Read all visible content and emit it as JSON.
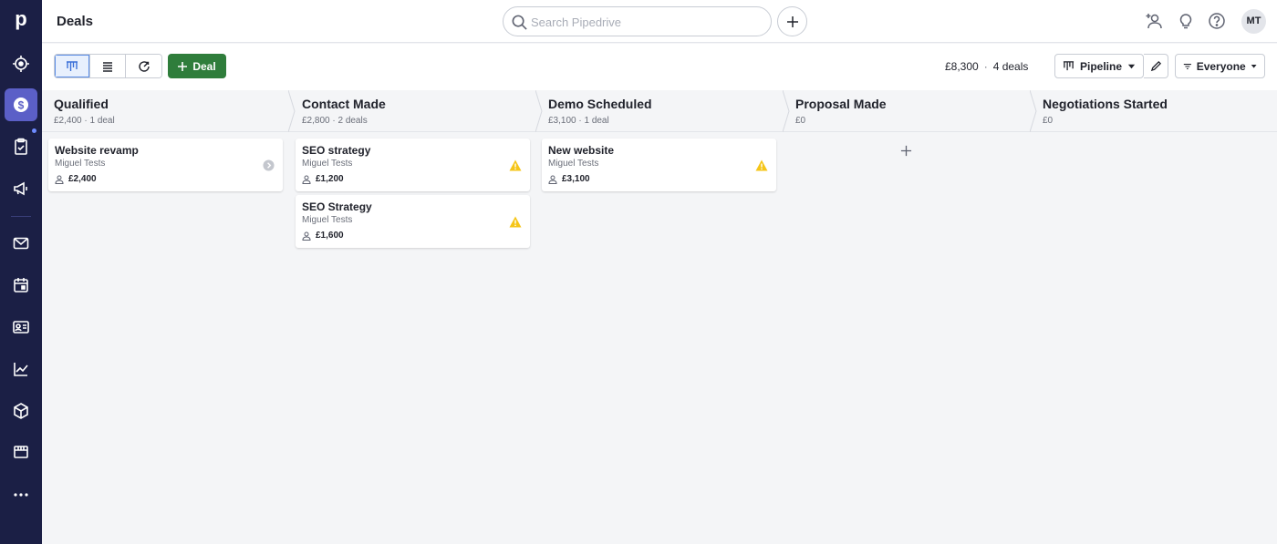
{
  "app": {
    "logo": "p"
  },
  "sidebar": {
    "items": [
      {
        "icon": "target-icon",
        "name": "leads"
      },
      {
        "icon": "dollar-icon",
        "name": "deals",
        "active": true
      },
      {
        "icon": "clipboard-check-icon",
        "name": "activities"
      },
      {
        "icon": "megaphone-icon",
        "name": "campaigns"
      },
      {
        "icon": "mail-icon",
        "name": "mail"
      },
      {
        "icon": "calendar-icon",
        "name": "calendar"
      },
      {
        "icon": "contacts-card-icon",
        "name": "contacts"
      },
      {
        "icon": "chart-line-icon",
        "name": "insights"
      },
      {
        "icon": "box-icon",
        "name": "products"
      },
      {
        "icon": "store-icon",
        "name": "marketplace"
      },
      {
        "icon": "more-dots-icon",
        "name": "more"
      }
    ]
  },
  "header": {
    "title": "Deals",
    "search_placeholder": "Search Pipedrive",
    "avatar_initials": "MT"
  },
  "toolbar": {
    "add_deal_label": "Deal",
    "summary_value": "£8,300",
    "summary_separator": "·",
    "summary_count": "4 deals",
    "pipeline_label": "Pipeline",
    "filter_label": "Everyone"
  },
  "stages": [
    {
      "name": "Qualified",
      "meta": "£2,400 · 1 deal"
    },
    {
      "name": "Contact Made",
      "meta": "£2,800 · 2 deals"
    },
    {
      "name": "Demo Scheduled",
      "meta": "£3,100 · 1 deal"
    },
    {
      "name": "Proposal Made",
      "meta": "£0"
    },
    {
      "name": "Negotiations Started",
      "meta": "£0"
    }
  ],
  "deals": [
    {
      "title": "Website revamp",
      "owner": "Miguel Tests",
      "value": "£2,400",
      "status": "neutral-arrow-icon"
    },
    {
      "title": "SEO strategy",
      "owner": "Miguel Tests",
      "value": "£1,200",
      "status": "warning-icon"
    },
    {
      "title": "SEO Strategy",
      "owner": "Miguel Tests",
      "value": "£1,600",
      "status": "warning-icon"
    },
    {
      "title": "New website",
      "owner": "Miguel Tests",
      "value": "£3,100",
      "status": "warning-icon"
    }
  ],
  "colors": {
    "sidebar_bg": "#1b1f45",
    "sidebar_active": "#5b5fc7",
    "add_deal_green": "#2f7d3b",
    "warning_yellow": "#f5c518",
    "view_active_blue": "#5a8de6"
  }
}
